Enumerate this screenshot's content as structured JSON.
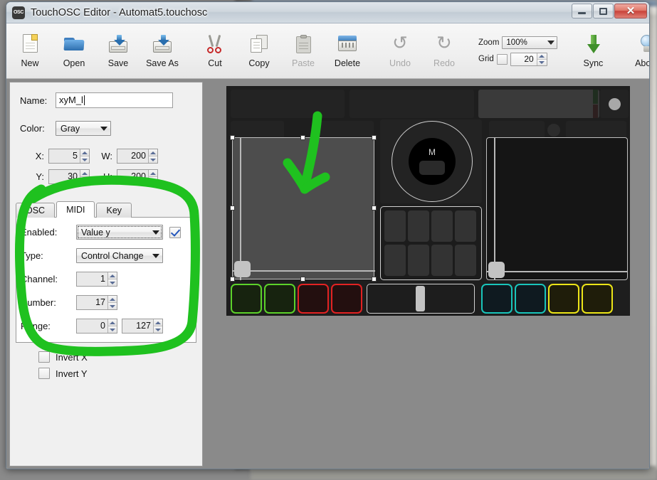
{
  "window": {
    "title": "TouchOSC Editor - Automat5.touchosc",
    "app_icon_label": "OSC",
    "controls": {
      "minimize": "Minimize",
      "maximize": "Maximize",
      "close": "✕"
    }
  },
  "toolbar": {
    "buttons": [
      {
        "label": "New",
        "icon": "new-document-icon",
        "enabled": true
      },
      {
        "label": "Open",
        "icon": "open-folder-icon",
        "enabled": true
      },
      {
        "label": "Save",
        "icon": "save-disk-icon",
        "enabled": true
      },
      {
        "label": "Save As",
        "icon": "save-as-disk-icon",
        "enabled": true
      },
      {
        "label": "Cut",
        "icon": "scissors-icon",
        "enabled": true
      },
      {
        "label": "Copy",
        "icon": "copy-pages-icon",
        "enabled": true
      },
      {
        "label": "Paste",
        "icon": "clipboard-icon",
        "enabled": false
      },
      {
        "label": "Delete",
        "icon": "delete-icon",
        "enabled": true
      },
      {
        "label": "Undo",
        "icon": "undo-arrow-icon",
        "enabled": false
      },
      {
        "label": "Redo",
        "icon": "redo-arrow-icon",
        "enabled": false
      },
      {
        "label": "Sync",
        "icon": "sync-down-arrow-icon",
        "enabled": true
      },
      {
        "label": "About",
        "icon": "lightbulb-icon",
        "enabled": true
      }
    ],
    "zoom_label": "Zoom",
    "zoom_value": "100%",
    "grid_label": "Grid",
    "grid_checked": false,
    "grid_value": "20"
  },
  "properties": {
    "name_label": "Name:",
    "name_value": "xyM_l",
    "color_label": "Color:",
    "color_value": "Gray",
    "x_label": "X:",
    "x_value": "5",
    "w_label": "W:",
    "w_value": "200",
    "y_label": "Y:",
    "y_value": "30",
    "h_label": "H:",
    "h_value": "200",
    "tabs": [
      {
        "label": "OSC",
        "active": false
      },
      {
        "label": "MIDI",
        "active": true
      },
      {
        "label": "Key",
        "active": false
      }
    ],
    "midi": {
      "enabled_label": "Enabled:",
      "enabled_value": "Value y",
      "enabled_checked": true,
      "type_label": "Type:",
      "type_value": "Control Change",
      "channel_label": "Channel:",
      "channel_value": "1",
      "number_label": "Number:",
      "number_value": "17",
      "range_label": "Range:",
      "range_min": "0",
      "range_max": "127"
    },
    "invert_x_label": "Invert X",
    "invert_x_checked": false,
    "invert_y_label": "Invert Y",
    "invert_y_checked": false
  },
  "canvas": {
    "background_color": "#8a8a8a",
    "layout_color": "#1e1e1e",
    "rotary_label": "M",
    "selected_widget": "xy-pad-left",
    "colors": {
      "green": "#5cd22a",
      "red": "#e32222",
      "teal": "#19c5bb",
      "yellow": "#ece517",
      "white": "#d0d0d0",
      "selection_handle": "#ffffff"
    },
    "buttons_row": [
      {
        "name": "pad-green-1",
        "color": "#5cd22a"
      },
      {
        "name": "pad-green-2",
        "color": "#5cd22a"
      },
      {
        "name": "pad-red-1",
        "color": "#e32222"
      },
      {
        "name": "pad-red-2",
        "color": "#e32222"
      },
      {
        "name": "pad-teal-1",
        "color": "#19c5bb"
      },
      {
        "name": "pad-teal-2",
        "color": "#19c5bb"
      },
      {
        "name": "pad-yellow-1",
        "color": "#ece517"
      },
      {
        "name": "pad-yellow-2",
        "color": "#ece517"
      }
    ]
  },
  "annotation": {
    "color": "#1fc11f",
    "shapes": [
      "arrow-pointing-down-to-xy-pad",
      "circle-around-midi-settings"
    ]
  }
}
